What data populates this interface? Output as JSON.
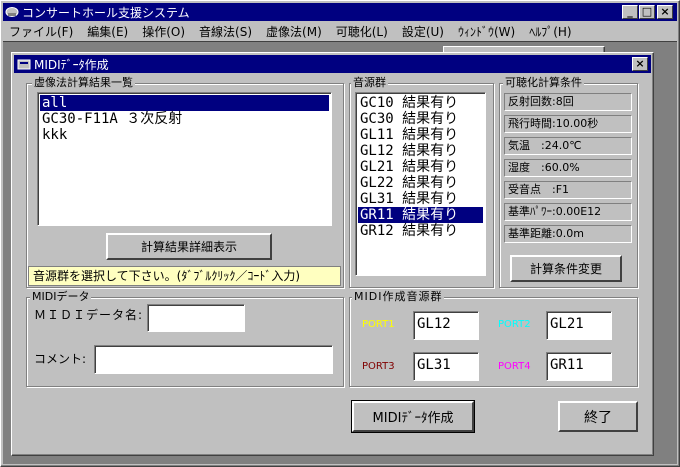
{
  "app": {
    "title": "コンサートホール支援システム",
    "menu": [
      "ファイル(F)",
      "編集(E)",
      "操作(O)",
      "音線法(S)",
      "虚像法(M)",
      "可聴化(L)",
      "設定(U)",
      "ｳｨﾝﾄﾞｳ(W)",
      "ﾍﾙﾌﾟ(H)"
    ]
  },
  "dialog": {
    "title": "MIDIﾃﾞｰﾀ作成",
    "results_group": {
      "label": "虚像法計算結果一覧",
      "items": [
        "all",
        "GC30-F11A ３次反射",
        "kkk"
      ],
      "selected_index": 0,
      "detail_button": "計算結果詳細表示"
    },
    "source_group": {
      "label": "音源群",
      "items": [
        "GC10 結果有り",
        "GC30 結果有り",
        "GL11 結果有り",
        "GL12 結果有り",
        "GL21 結果有り",
        "GL22 結果有り",
        "GL31 結果有り",
        "GR11 結果有り",
        "GR12 結果有り"
      ],
      "selected_index": 7
    },
    "conditions_group": {
      "label": "可聴化計算条件",
      "items": [
        "反射回数:8回",
        "飛行時間:10.00秒",
        "気温　:24.0℃",
        "湿度　:60.0%",
        "受音点　:F1",
        "基準ﾊﾟﾜｰ:0.00E12",
        "基準距離:0.0m"
      ],
      "change_button": "計算条件変更"
    },
    "hint": "音源群を選択して下さい。(ﾀﾞﾌﾞﾙｸﾘｯｸ／ｺｰﾄﾞ入力)",
    "midi_group": {
      "label": "MIDIデータ",
      "name_label": "ＭＩＤＩデータ名:",
      "name_value": "",
      "comment_label": "コメント:",
      "comment_value": ""
    },
    "midi_source_group": {
      "label": "MIDI作成音源群",
      "ports": [
        {
          "label": "PORT1",
          "value": "GL12",
          "color": "#ffff00"
        },
        {
          "label": "PORT2",
          "value": "GL21",
          "color": "#00ffff"
        },
        {
          "label": "PORT3",
          "value": "GL31",
          "color": "#800000"
        },
        {
          "label": "PORT4",
          "value": "GR11",
          "color": "#ff00ff"
        }
      ]
    },
    "create_button": "MIDIﾃﾞｰﾀ作成",
    "close_button": "終了"
  },
  "colors": {
    "title_bar": "#000080",
    "face": "#c0c0c0",
    "hint_bg": "#ffffc0"
  }
}
